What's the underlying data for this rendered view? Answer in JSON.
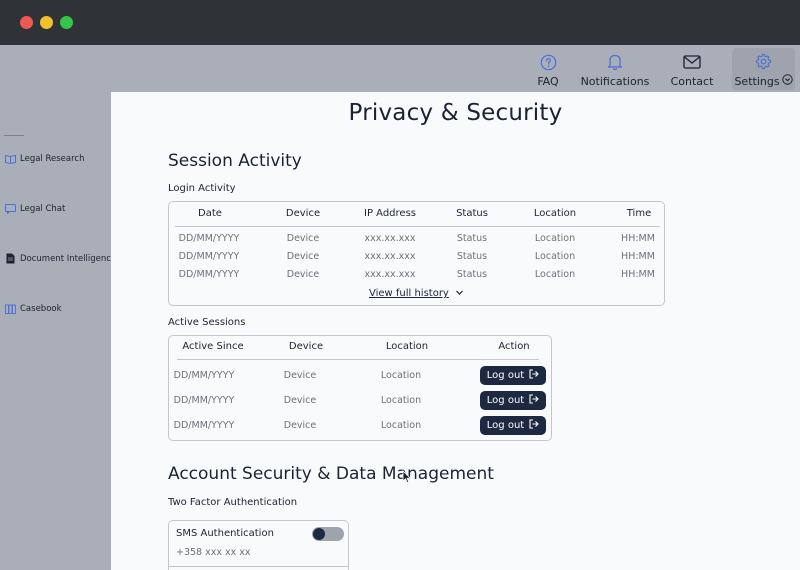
{
  "topnav": {
    "faq": "FAQ",
    "notifications": "Notifications",
    "contact": "Contact",
    "settings": "Settings"
  },
  "sidebar": {
    "items": [
      {
        "label": "Legal Research",
        "icon": "book-icon"
      },
      {
        "label": "Legal Chat",
        "icon": "chat-icon"
      },
      {
        "label": "Document Intelligence",
        "icon": "document-icon"
      },
      {
        "label": "Casebook",
        "icon": "library-icon"
      }
    ]
  },
  "page": {
    "title": "Privacy & Security"
  },
  "session_activity": {
    "heading": "Session Activity",
    "login_activity": {
      "label": "Login Activity",
      "columns": [
        "Date",
        "Device",
        "IP Address",
        "Status",
        "Location",
        "Time"
      ],
      "rows": [
        [
          "DD/MM/YYYY",
          "Device",
          "xxx.xx.xxx",
          "Status",
          "Location",
          "HH:MM"
        ],
        [
          "DD/MM/YYYY",
          "Device",
          "xxx.xx.xxx",
          "Status",
          "Location",
          "HH:MM"
        ],
        [
          "DD/MM/YYYY",
          "Device",
          "xxx.xx.xxx",
          "Status",
          "Location",
          "HH:MM"
        ]
      ],
      "view_history": "View full history"
    },
    "active_sessions": {
      "label": "Active Sessions",
      "columns": [
        "Active Since",
        "Device",
        "Location",
        "Action"
      ],
      "rows": [
        [
          "DD/MM/YYYY",
          "Device",
          "Location"
        ],
        [
          "DD/MM/YYYY",
          "Device",
          "Location"
        ],
        [
          "DD/MM/YYYY",
          "Device",
          "Location"
        ]
      ],
      "logout_label": "Log out"
    }
  },
  "account_security": {
    "heading": "Account Security & Data Management",
    "two_factor": {
      "label": "Two Factor Authentication",
      "sms_label": "SMS Authentication",
      "sms_phone": "+358 xxx xx xx",
      "sms_enabled": false
    }
  },
  "colors": {
    "titlebar": "#2f3236",
    "chrome": "#a9aeb8",
    "content_bg": "#f9fafb",
    "primary_button": "#1d2941",
    "accent_icon": "#4a6fd8"
  }
}
